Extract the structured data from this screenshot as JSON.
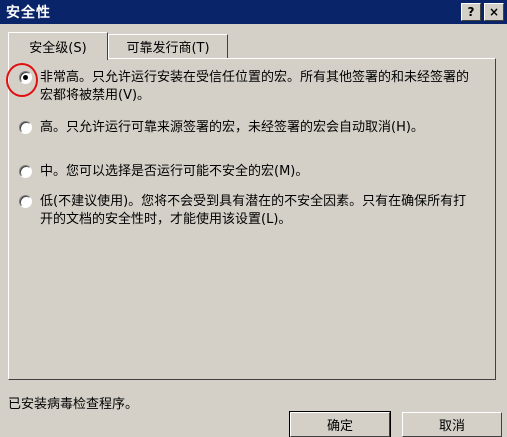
{
  "window": {
    "title": "安全性",
    "help_glyph": "?",
    "close_glyph": "×"
  },
  "tabs": [
    {
      "label": "安全级(S)",
      "selected": true
    },
    {
      "label": "可靠发行商(T)",
      "selected": false
    }
  ],
  "options": [
    {
      "text": "非常高。只允许运行安装在受信任位置的宏。所有其他签署的和未经签署的宏都将被禁用(V)。",
      "checked": true
    },
    {
      "text": "高。只允许运行可靠来源签署的宏，未经签署的宏会自动取消(H)。",
      "checked": false
    },
    {
      "text": "中。您可以选择是否运行可能不安全的宏(M)。",
      "checked": false
    },
    {
      "text": "低(不建议使用)。您将不会受到具有潜在的不安全因素。只有在确保所有打开的文档的安全性时，才能使用该设置(L)。",
      "checked": false
    }
  ],
  "status": {
    "text": "已安装病毒检查程序。"
  },
  "buttons": {
    "ok": "确定",
    "cancel": "取消"
  },
  "colors": {
    "titlebar": "#0a246a",
    "annotation": "#e01010"
  }
}
